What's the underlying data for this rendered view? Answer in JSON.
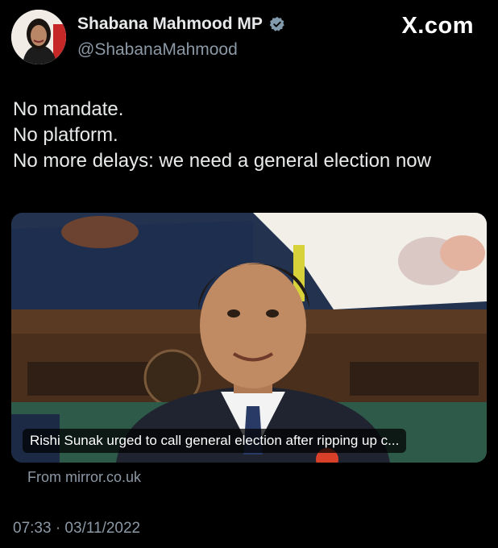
{
  "author": {
    "display_name": "Shabana Mahmood MP",
    "handle": "@ShabanaMahmood",
    "verified_icon": "verified-badge-icon",
    "avatar_icon": "profile-photo"
  },
  "brand": {
    "label": "X.com"
  },
  "tweet": {
    "lines": [
      "No mandate.",
      "No platform.",
      "No more delays: we need a general election now"
    ]
  },
  "link_card": {
    "caption": "Rishi Sunak urged to call general election after ripping up c...",
    "source": "From mirror.co.uk",
    "image_icon": "news-photo"
  },
  "timestamp": "07:33 · 03/11/2022",
  "colors": {
    "background": "#000000",
    "text": "#e7e9ea",
    "secondary_text": "#8b98a5",
    "verified_badge": "#829aab"
  }
}
